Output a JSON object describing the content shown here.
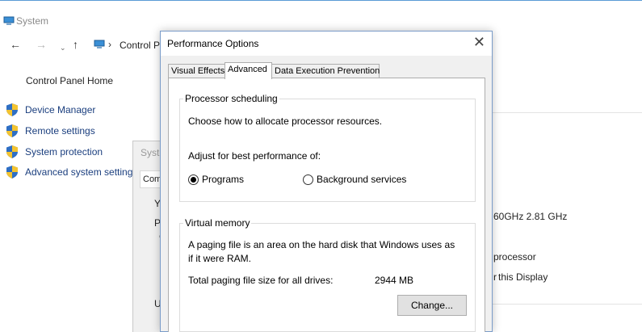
{
  "system_window": {
    "title": "System",
    "nav": {
      "back_glyph": "←",
      "forward_glyph": "→",
      "recent_glyph": "⌄",
      "up_glyph": "↑",
      "address_separator": "›",
      "address_text": "Control P"
    },
    "sidebar": {
      "home_label": "Control Panel Home",
      "links": [
        {
          "label": "Device Manager",
          "icon": "shield-icon"
        },
        {
          "label": "Remote settings",
          "icon": "shield-icon"
        },
        {
          "label": "System protection",
          "icon": "shield-icon"
        },
        {
          "label": "Advanced system setting",
          "icon": "shield-icon"
        }
      ]
    },
    "behind_dialog": {
      "title_fragment": "Syste",
      "tab_fragment": "Com",
      "text_fragments": [
        "Y",
        "P",
        "'",
        "U"
      ]
    },
    "right_content": {
      "processor_speed": "60GHz  2.81 GHz",
      "processor_type": "processor",
      "display_text": "this Display",
      "dash": "r"
    }
  },
  "performance_options": {
    "title": "Performance Options",
    "close_glyph": "✕",
    "tabs": [
      {
        "label": "Visual Effects",
        "active": false
      },
      {
        "label": "Advanced",
        "active": true
      },
      {
        "label": "Data Execution Prevention",
        "active": false
      }
    ],
    "processor_scheduling": {
      "label": "Processor scheduling",
      "description": "Choose how to allocate processor resources.",
      "adjust_label": "Adjust for best performance of:",
      "options": [
        {
          "label": "Programs",
          "selected": true
        },
        {
          "label": "Background services",
          "selected": false
        }
      ]
    },
    "virtual_memory": {
      "label": "Virtual memory",
      "description_line1": "A paging file is an area on the hard disk that Windows uses as",
      "description_line2": "if it were RAM.",
      "total_label": "Total paging file size for all drives:",
      "total_value": "2944 MB",
      "change_button": "Change..."
    }
  },
  "colors": {
    "link": "#1a3e7e",
    "dialog_border": "#7a9cc9",
    "dialog_bg": "#f0f0f0"
  }
}
